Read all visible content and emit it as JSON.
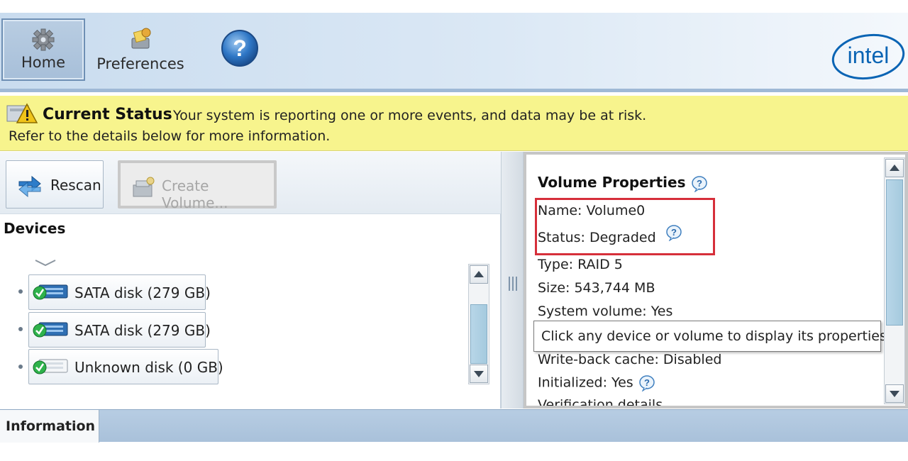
{
  "toolbar": {
    "home_label": "Home",
    "preferences_label": "Preferences",
    "help_icon": "help-icon",
    "brand": "intel"
  },
  "status": {
    "title": "Current Status",
    "message": "Your system is reporting one or more events, and data may be at risk.",
    "message_2": "Refer to the details below for more information.",
    "background_color": "#f7f48d"
  },
  "actions": {
    "rescan_label": "Rescan",
    "create_volume_label": "Create Volume..."
  },
  "devices": {
    "title": "Devices",
    "items": [
      {
        "label": "SATA disk (279 GB)",
        "icon": "disk-ok-icon"
      },
      {
        "label": "SATA disk (279 GB)",
        "icon": "disk-ok-icon"
      },
      {
        "label": "Unknown disk (0 GB)",
        "icon": "disk-unknown-icon"
      }
    ]
  },
  "volume_properties": {
    "title": "Volume Properties",
    "name": "Name: Volume0",
    "status": "Status: Degraded",
    "type": "Type: RAID 5",
    "size": "Size: 543,744 MB",
    "system_volume": "System volume: Yes",
    "write_back_cache": "Write-back cache: Disabled",
    "initialized": "Initialized: Yes",
    "verification": "Verification details",
    "highlight_color": "#d62f3a"
  },
  "tooltip": {
    "text": "Click any device or volume to display its properties."
  },
  "bottom_tabs": {
    "information_label": "Information"
  }
}
